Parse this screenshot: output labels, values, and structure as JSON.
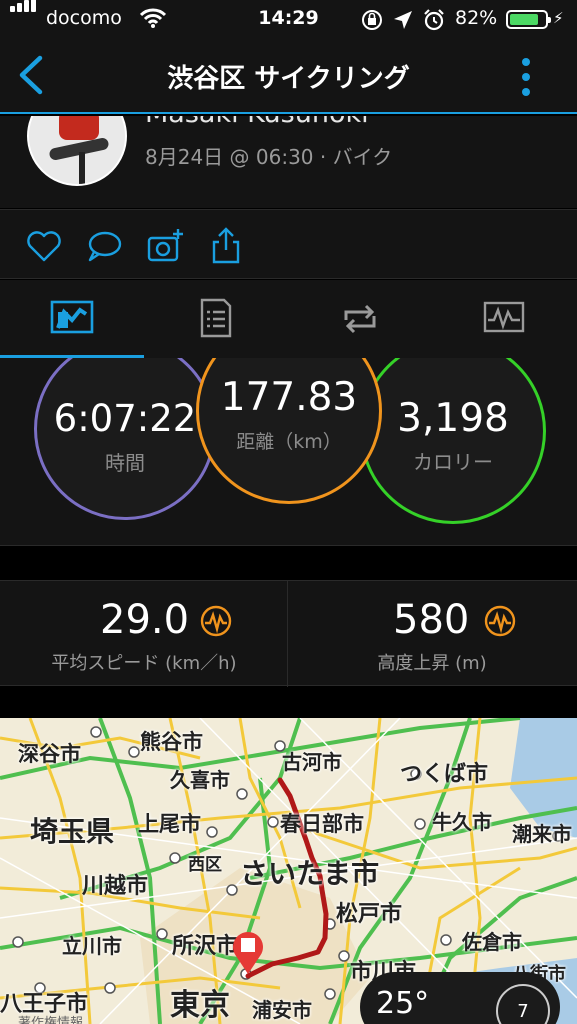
{
  "status_bar": {
    "carrier": "docomo",
    "time": "14:29",
    "battery_pct": "82%",
    "battery_level": 0.82,
    "battery_color": "#4cd964"
  },
  "header": {
    "title": "渋谷区 サイクリング",
    "back_icon": "chevron-left-icon",
    "more_icon": "vertical-dots-icon",
    "accent": "#1a9fe0"
  },
  "activity": {
    "user_name": "Masaki Kusunoki",
    "meta": "8月24日 @ 06:30 · バイク"
  },
  "actions": [
    "heart-icon",
    "comment-icon",
    "add-photo-icon",
    "share-icon"
  ],
  "tabs": [
    {
      "icon": "map-stats-icon",
      "active": true
    },
    {
      "icon": "laps-list-icon",
      "active": false
    },
    {
      "icon": "repeat-icon",
      "active": false
    },
    {
      "icon": "chart-icon",
      "active": false
    }
  ],
  "summary": {
    "time": {
      "value": "6:07:22",
      "label": "時間",
      "color": "#7b6fc4"
    },
    "distance": {
      "value": "177.83",
      "label": "距離（km）",
      "color": "#f0941d"
    },
    "calories": {
      "value": "3,198",
      "label": "カロリー",
      "color": "#35d128"
    }
  },
  "metrics": [
    {
      "value": "29.0",
      "label": "平均スピード (km／h)",
      "icon": "activity-wave-icon"
    },
    {
      "value": "580",
      "label": "高度上昇 (m)",
      "icon": "activity-wave-icon"
    }
  ],
  "map": {
    "places": {
      "fukaya": "深谷市",
      "kumagaya": "熊谷市",
      "koga": "古河市",
      "tsukuba": "つくば市",
      "kuki": "久喜市",
      "ushiku": "牛久市",
      "ageo": "上尾市",
      "kasukabe": "春日部市",
      "saitama_pref": "埼玉県",
      "nishi": "西区",
      "saitama": "さいたま市",
      "kawagoe": "川越市",
      "matsudo": "松戸市",
      "narashino": "潮来市",
      "tachikawa": "立川市",
      "tokorozawa": "所沢市",
      "sakura": "佐倉市",
      "ichikawa": "市川市",
      "yachimata": "八街市",
      "hachioji": "八王子市",
      "tokyo": "東京",
      "urayasu": "浦安市"
    },
    "route_color": "#b01818",
    "attribution": "著作権情報"
  },
  "weather": {
    "temp": "25°",
    "wind": "7"
  }
}
